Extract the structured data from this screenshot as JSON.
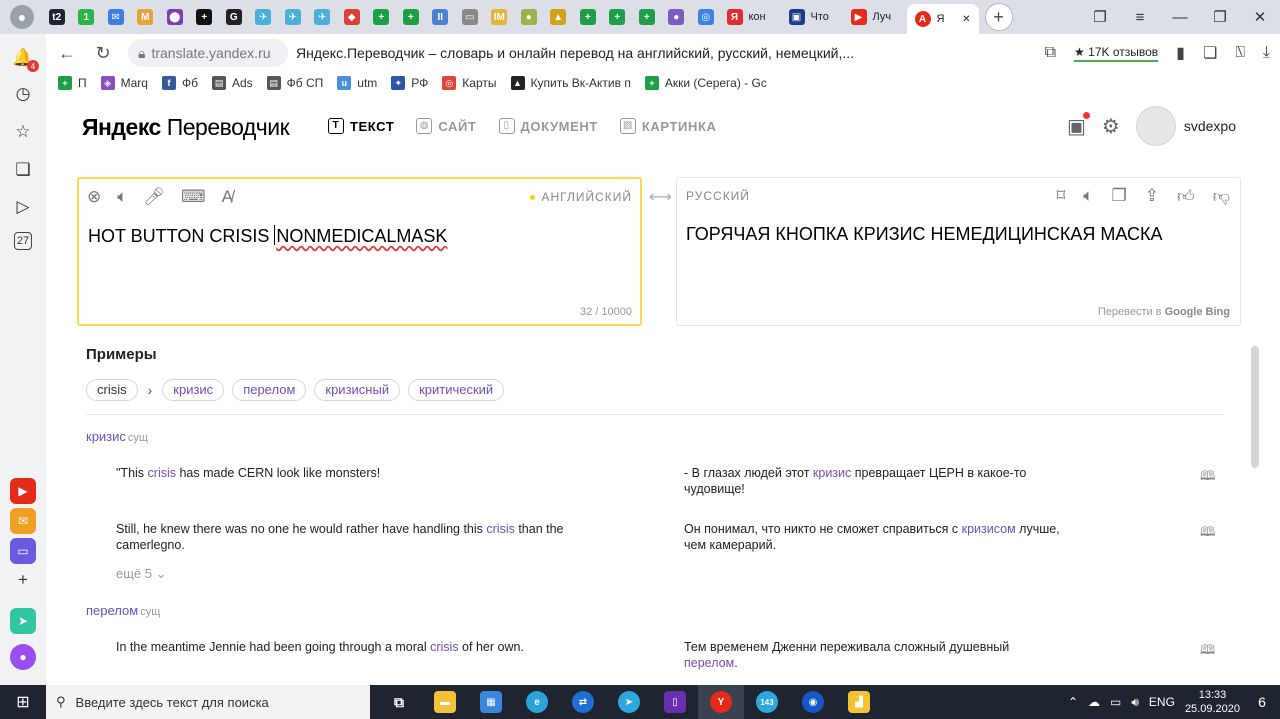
{
  "browser": {
    "profile_icon": "person-icon",
    "tabs": [
      {
        "name": "t2",
        "label": "t2",
        "color": "#1f2530"
      },
      {
        "name": "green-circle",
        "label": "1",
        "color": "#2eb24b"
      },
      {
        "name": "mail",
        "label": "✉",
        "color": "#3c7fe0"
      },
      {
        "name": "gmail",
        "label": "M",
        "color": "#e9a23b"
      },
      {
        "name": "purple",
        "label": "⬤",
        "color": "#7b3fb5"
      },
      {
        "name": "plus-black",
        "label": "+",
        "color": "#111111"
      },
      {
        "name": "google",
        "label": "G",
        "color": "#222222"
      },
      {
        "name": "plane1",
        "label": "✈",
        "color": "#4ab0d9"
      },
      {
        "name": "plane2",
        "label": "✈",
        "color": "#4ab0d9"
      },
      {
        "name": "plane3",
        "label": "✈",
        "color": "#4ab0d9"
      },
      {
        "name": "cube",
        "label": "◆",
        "color": "#d9403a"
      },
      {
        "name": "green-plus1",
        "label": "+",
        "color": "#1e9e46"
      },
      {
        "name": "green-plus2",
        "label": "+",
        "color": "#1e9e46"
      },
      {
        "name": "pause",
        "label": "II",
        "color": "#4a7fd4"
      },
      {
        "name": "doc",
        "label": "▭",
        "color": "#888888"
      },
      {
        "name": "im",
        "label": "IM",
        "color": "#e5b53a"
      },
      {
        "name": "ball",
        "label": "●",
        "color": "#9cb34a"
      },
      {
        "name": "shield",
        "label": "▲",
        "color": "#d4a21a"
      },
      {
        "name": "green-plus3",
        "label": "+",
        "color": "#1e9e46"
      },
      {
        "name": "green-plus4",
        "label": "+",
        "color": "#1e9e46"
      },
      {
        "name": "green-plus5",
        "label": "+",
        "color": "#1e9e46"
      },
      {
        "name": "purple-sq",
        "label": "●",
        "color": "#7e5bc2"
      },
      {
        "name": "maps",
        "label": "◎",
        "color": "#3d82e6"
      }
    ],
    "text_tabs": [
      {
        "label": "кон",
        "color": "#e22c2c",
        "icon": "Я"
      },
      {
        "label": "Что",
        "color": "#1b3b8c",
        "icon": "▣"
      },
      {
        "label": "Луч",
        "color": "#e52a1a",
        "icon": "▶"
      }
    ],
    "active_tab": {
      "label": "Я",
      "icon": "translate-icon"
    },
    "url_domain": "translate.yandex.ru",
    "page_title": "Яндекс.Переводчик – словарь и онлайн перевод на английский, русский, немецкий,...",
    "reviews": "★ 17K отзывов",
    "bookmarks": [
      {
        "label": "П",
        "color": "#1e9e46",
        "icon": "+"
      },
      {
        "label": "Marq",
        "color": "#8a4fbf",
        "icon": "◈"
      },
      {
        "label": "Фб",
        "color": "#3b5998",
        "icon": "f"
      },
      {
        "label": "Ads",
        "color": "#555555",
        "icon": "▤"
      },
      {
        "label": "Фб СП",
        "color": "#555555",
        "icon": "▤"
      },
      {
        "label": "utm",
        "color": "#4a90d9",
        "icon": "u"
      },
      {
        "label": "РФ",
        "color": "#2a55a8",
        "icon": "✦"
      },
      {
        "label": "Карты",
        "color": "#e0453a",
        "icon": "◎"
      },
      {
        "label": "Купить Вк-Актив п",
        "color": "#222222",
        "icon": "▲"
      },
      {
        "label": "Акки (Серега) - Gc",
        "color": "#1e9e46",
        "icon": "+"
      }
    ],
    "sidebar_badge": "4"
  },
  "page": {
    "logo_brand": "Яндекс",
    "logo_product": "Переводчик",
    "modes": [
      {
        "label": "ТЕКСТ",
        "icon": "T",
        "active": true
      },
      {
        "label": "САЙТ",
        "icon": "◍",
        "active": false
      },
      {
        "label": "ДОКУМЕНТ",
        "icon": "▯",
        "active": false
      },
      {
        "label": "КАРТИНКА",
        "icon": "▨",
        "active": false
      }
    ],
    "username": "svdexpo",
    "source": {
      "language": "АНГЛИЙСКИЙ",
      "text_prefix": "HOT BUTTON CRISIS ",
      "text_error": "NONMEDICALMASK",
      "char_count": "32 / 10000"
    },
    "target": {
      "language": "РУССКИЙ",
      "text": "ГОРЯЧАЯ КНОПКА КРИЗИС НЕМЕДИЦИНСКАЯ МАСКА",
      "translate_in_label": "Перевести в",
      "engine1": "Google",
      "engine2": "Bing"
    },
    "examples": {
      "heading": "Примеры",
      "source_word": "crisis",
      "translations": [
        "кризис",
        "перелом",
        "кризисный",
        "критический"
      ],
      "groups": [
        {
          "pos_word": "кризис",
          "pos_type": "сущ",
          "items": [
            {
              "en": [
                "\"This ",
                "crisis",
                " has made CERN look like monsters!"
              ],
              "ru": [
                "- В глазах людей этот ",
                "кризис",
                " превращает ЦЕРН в какое-то чудовище!"
              ]
            },
            {
              "en": [
                "Still, he knew there was no one he would rather have handling this ",
                "crisis",
                " than the camerlegno."
              ],
              "ru": [
                "Он понимал, что никто не сможет справиться с ",
                "кризисом",
                " лучше, чем камерарий."
              ]
            }
          ],
          "more": "ещё 5"
        },
        {
          "pos_word": "перелом",
          "pos_type": "сущ",
          "items": [
            {
              "en": [
                "In the meantime Jennie had been going through a moral ",
                "crisis",
                " of her own."
              ],
              "ru": [
                "Тем временем Дженни переживала сложный душевный ",
                "перелом",
                "."
              ]
            }
          ]
        }
      ]
    }
  },
  "taskbar": {
    "search_placeholder": "Введите здесь текст для поиска",
    "language": "ENG",
    "time": "13:33",
    "date": "25.09.2020",
    "notification_count": "6",
    "telegram_badge": "143"
  }
}
